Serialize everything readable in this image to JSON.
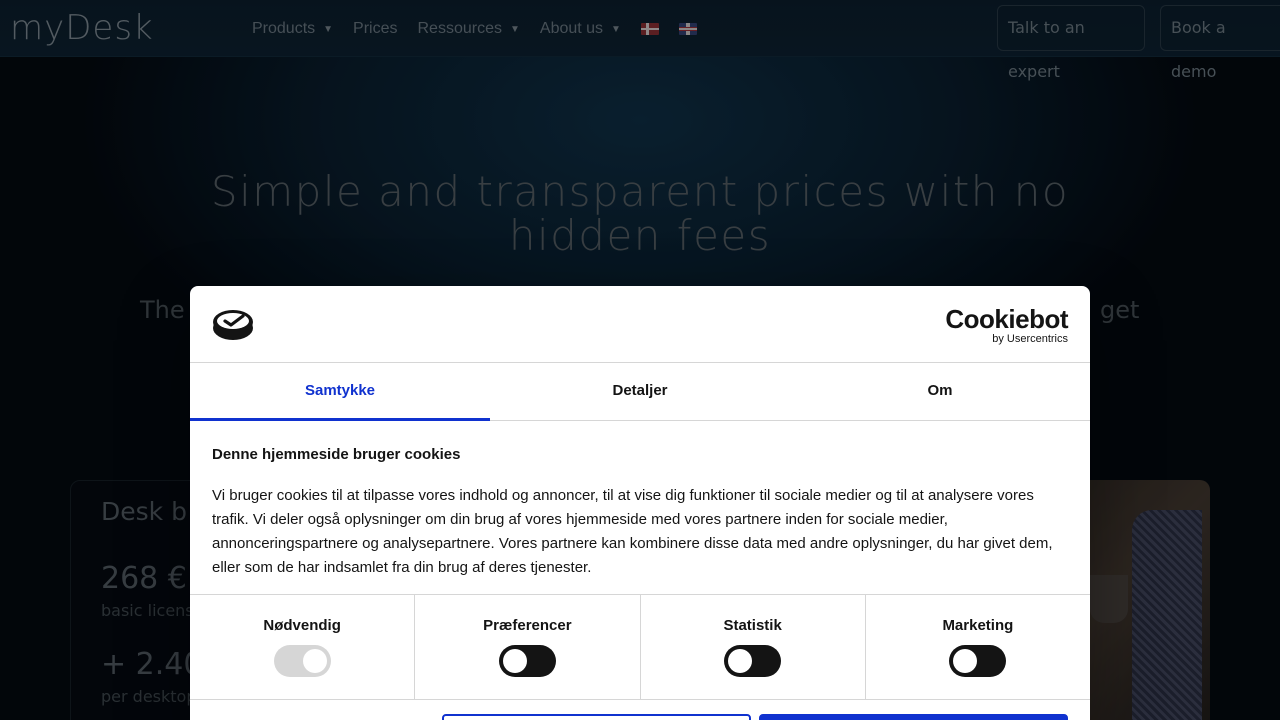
{
  "nav": {
    "logo": "myDesk",
    "items": [
      {
        "label": "Products",
        "dropdown": true
      },
      {
        "label": "Prices",
        "dropdown": false
      },
      {
        "label": "Ressources",
        "dropdown": true
      },
      {
        "label": "About us",
        "dropdown": true
      }
    ],
    "talk_label": "Talk to an expert",
    "demo_label": "Book a demo"
  },
  "hero": {
    "title": "Simple and transparent prices with no hidden fees",
    "sub_left": "The",
    "sub_right": "get"
  },
  "card": {
    "title": "Desk b",
    "price": "268 €",
    "note1": "basic licens",
    "price2": "+ 2.40",
    "note2": "per desktop"
  },
  "cookie": {
    "brand": "Cookiebot",
    "brand_by": "by Usercentrics",
    "tabs": [
      "Samtykke",
      "Detaljer",
      "Om"
    ],
    "active_tab": 0,
    "heading": "Denne hjemmeside bruger cookies",
    "paragraph": "Vi bruger cookies til at tilpasse vores indhold og annoncer, til at vise dig funktioner til sociale medier og til at analysere vores trafik. Vi deler også oplysninger om din brug af vores hjemmeside med vores partnere inden for sociale medier, annonceringspartnere og analysepartnere. Vores partnere kan kombinere disse data med andre oplysninger, du har givet dem, eller som de har indsamlet fra din brug af deres tjenester.",
    "categories": [
      {
        "label": "Nødvendig",
        "checked": true,
        "disabled": true
      },
      {
        "label": "Præferencer",
        "checked": false,
        "disabled": false
      },
      {
        "label": "Statistik",
        "checked": false,
        "disabled": false
      },
      {
        "label": "Marketing",
        "checked": false,
        "disabled": false
      }
    ],
    "accent": "#1032cf"
  }
}
